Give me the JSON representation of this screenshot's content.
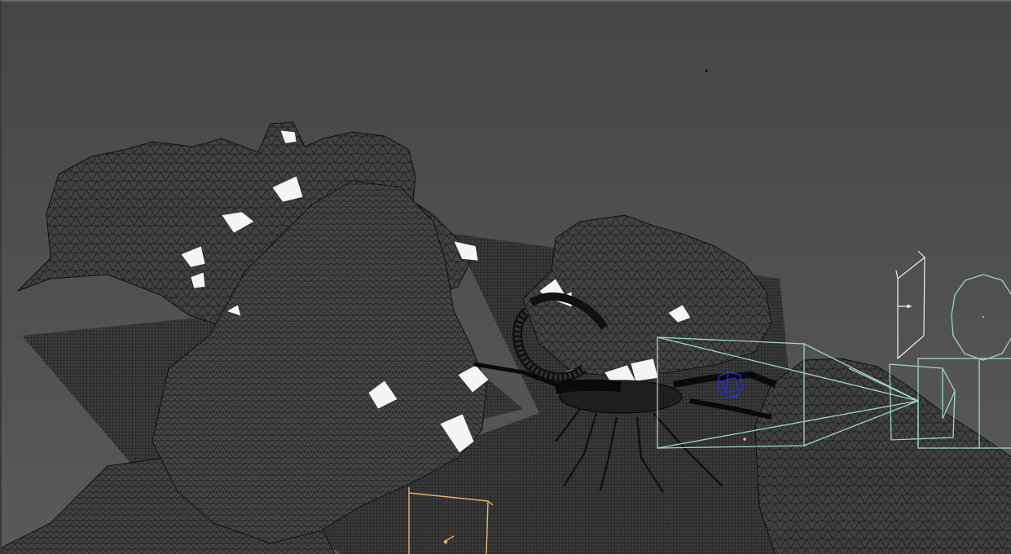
{
  "viewport": {
    "background_color": "#4e4e4e",
    "mesh_fill_color": "#3c3c3c",
    "wire_color": "#111111",
    "highlight_color": "#f4f4f4",
    "camera_color": "#9fd8bd",
    "light_color": "#e9b36a",
    "selection_color": "#2630d8",
    "helper_color": "#eeeeee"
  },
  "objects": [
    {
      "name": "ground-plane-left",
      "type": "plane"
    },
    {
      "name": "ground-plane-center",
      "type": "plane"
    },
    {
      "name": "rock-cluster-left",
      "type": "mesh"
    },
    {
      "name": "rock-front-center",
      "type": "mesh"
    },
    {
      "name": "rock-cluster-center",
      "type": "mesh"
    },
    {
      "name": "rock-right",
      "type": "mesh"
    },
    {
      "name": "rock-foreground-left",
      "type": "mesh"
    },
    {
      "name": "scorpion",
      "type": "mesh"
    },
    {
      "name": "scene-camera",
      "type": "camera"
    },
    {
      "name": "area-light",
      "type": "light"
    },
    {
      "name": "helper-plane",
      "type": "helper"
    },
    {
      "name": "helper-circle",
      "type": "helper"
    }
  ]
}
